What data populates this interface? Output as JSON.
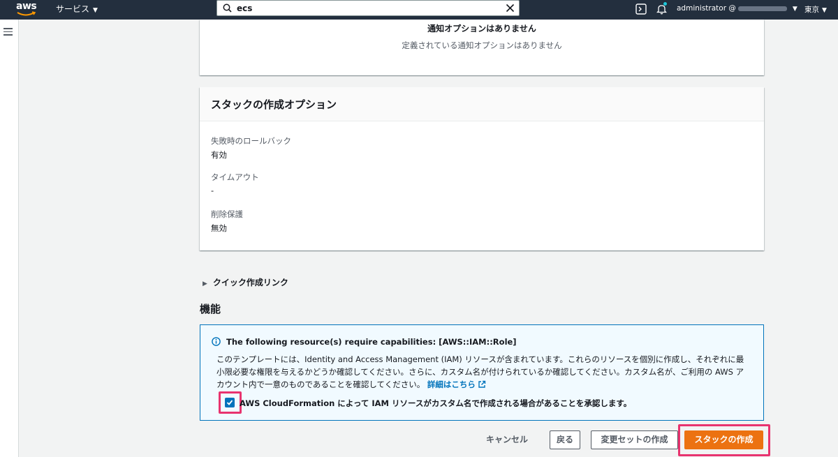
{
  "nav": {
    "logo_text": "aws",
    "services_label": "サービス",
    "search_value": "ecs",
    "account_label": "administrator @",
    "region_label": "東京"
  },
  "notifications": {
    "empty_title": "通知オプションはありません",
    "empty_description": "定義されている通知オプションはありません"
  },
  "stack_options": {
    "title": "スタックの作成オプション",
    "items": [
      {
        "label": "失敗時のロールバック",
        "value": "有効"
      },
      {
        "label": "タイムアウト",
        "value": "-"
      },
      {
        "label": "削除保護",
        "value": "無効"
      }
    ]
  },
  "quick_link": {
    "label": "クイック作成リンク"
  },
  "capabilities": {
    "section_title": "機能",
    "alert_title": "The following resource(s) require capabilities: [AWS::IAM::Role]",
    "alert_body": "このテンプレートには、Identity and Access Management (IAM) リソースが含まれています。これらのリソースを個別に作成し、それぞれに最小限必要な権限を与えるかどうか確認してください。さらに、カスタム名が付けられているか確認してください。カスタム名が、ご利用の AWS アカウント内で一意のものであることを確認してください。",
    "learn_more": "詳細はこちら",
    "ack_checked": true,
    "ack_label": "AWS CloudFormation によって IAM リソースがカスタム名で作成される場合があることを承認します。"
  },
  "footer": {
    "cancel": "キャンセル",
    "back": "戻る",
    "create_change_set": "変更セットの作成",
    "create_stack": "スタックの作成"
  },
  "colors": {
    "nav_bg": "#232f3e",
    "primary_button": "#ec7211",
    "info_border": "#0073bb",
    "info_bg": "#f1faff",
    "highlight": "#e8336f",
    "notification_dot": "#1ec7d9"
  },
  "icons": [
    "aws-logo",
    "caret-down-icon",
    "search-icon",
    "close-icon",
    "cloudshell-icon",
    "bell-icon",
    "hamburger-menu-icon",
    "caret-right-icon",
    "info-icon",
    "external-link-icon",
    "check-icon"
  ]
}
